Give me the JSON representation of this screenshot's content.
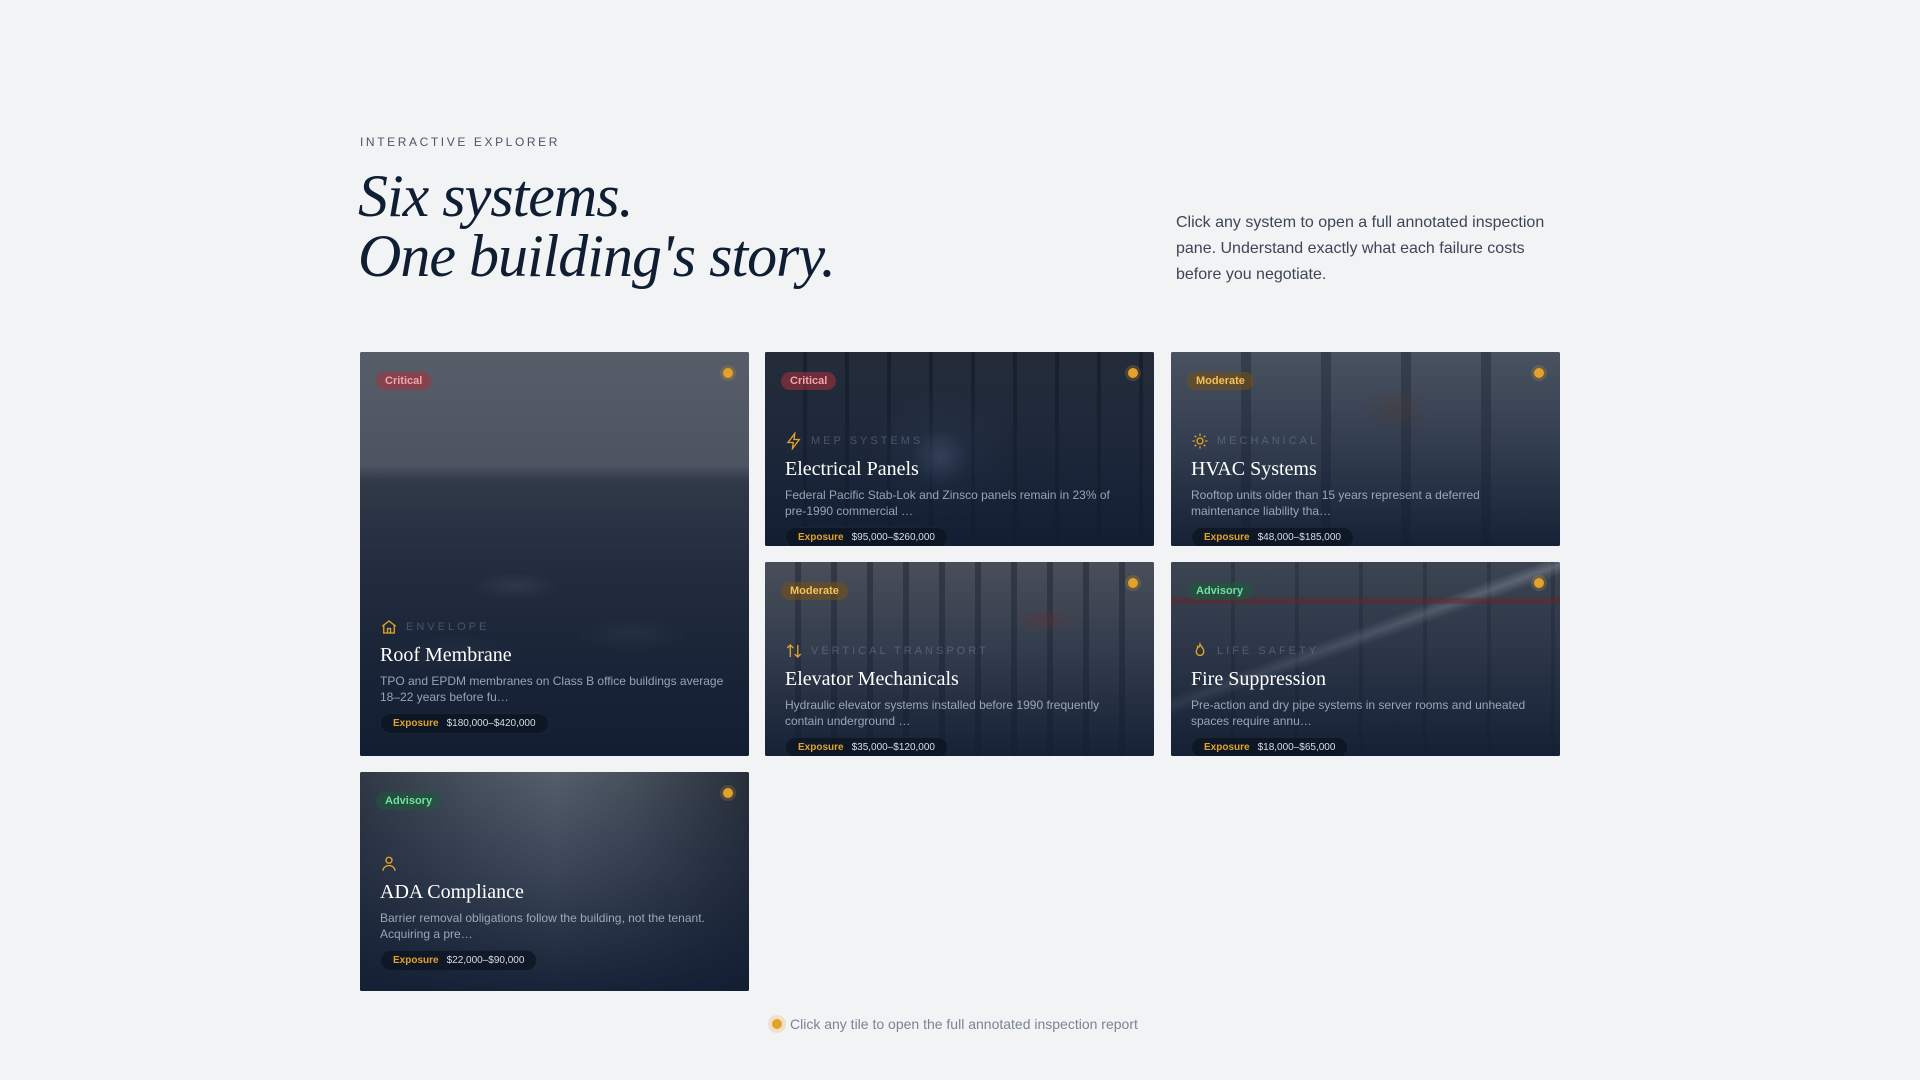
{
  "header": {
    "eyebrow": "INTERACTIVE EXPLORER",
    "headline_line1": "Six systems.",
    "headline_line2": "One building's story.",
    "intro": "Click any system to open a full annotated inspection pane. Understand exactly what each failure costs before you negotiate."
  },
  "tiles": [
    {
      "severity": "Critical",
      "category": "ENVELOPE",
      "icon": "house-icon",
      "title": "Roof Membrane",
      "desc": "TPO and EPDM membranes on Class B office buildings average 18–22 years before fu…",
      "exposure_label": "Exposure",
      "exposure": "$180,000–$420,000"
    },
    {
      "severity": "Critical",
      "category": "MEP SYSTEMS",
      "icon": "lightning-icon",
      "title": "Electrical Panels",
      "desc": "Federal Pacific Stab-Lok and Zinsco panels remain in 23% of pre-1990 commercial …",
      "exposure_label": "Exposure",
      "exposure": "$95,000–$260,000"
    },
    {
      "severity": "Moderate",
      "category": "MECHANICAL",
      "icon": "sun-icon",
      "title": "HVAC Systems",
      "desc": "Rooftop units older than 15 years represent a deferred maintenance liability tha…",
      "exposure_label": "Exposure",
      "exposure": "$48,000–$185,000"
    },
    {
      "severity": "Moderate",
      "category": "VERTICAL TRANSPORT",
      "icon": "arrows-up-down-icon",
      "title": "Elevator Mechanicals",
      "desc": "Hydraulic elevator systems installed before 1990 frequently contain underground …",
      "exposure_label": "Exposure",
      "exposure": "$35,000–$120,000"
    },
    {
      "severity": "Advisory",
      "category": "LIFE SAFETY",
      "icon": "flame-icon",
      "title": "Fire Suppression",
      "desc": "Pre-action and dry pipe systems in server rooms and unheated spaces require annu…",
      "exposure_label": "Exposure",
      "exposure": "$18,000–$65,000"
    },
    {
      "severity": "Advisory",
      "category": "",
      "icon": "person-icon",
      "title": "ADA Compliance",
      "desc": "Barrier removal obligations follow the building, not the tenant. Acquiring a pre…",
      "exposure_label": "Exposure",
      "exposure": "$22,000–$90,000"
    }
  ],
  "footer": {
    "hint": "Click any tile to open the full annotated inspection report"
  },
  "colors": {
    "accent": "#e3a22a",
    "critical": "#f3a4a8",
    "moderate": "#f5c15a",
    "advisory": "#6ee29c",
    "navy": "#0f1e33"
  }
}
